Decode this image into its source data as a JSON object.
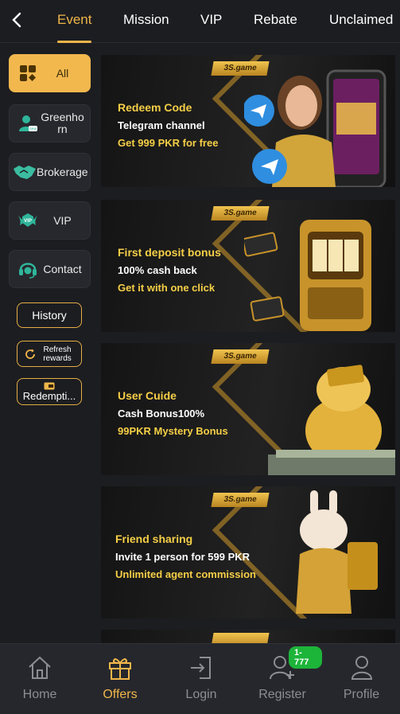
{
  "nav": {
    "back_icon": "chevron-left-icon",
    "tabs": [
      {
        "label": "Event",
        "active": true
      },
      {
        "label": "Mission"
      },
      {
        "label": "VIP"
      },
      {
        "label": "Rebate"
      },
      {
        "label": "Unclaimed"
      }
    ]
  },
  "sidebar": {
    "items": [
      {
        "label": "All",
        "icon": "grid-icon",
        "active": true
      },
      {
        "label": "Greenhorn",
        "icon": "newbie-avatar-icon"
      },
      {
        "label": "Brokerage",
        "icon": "handshake-icon"
      },
      {
        "label": "VIP",
        "icon": "vip-badge-icon"
      },
      {
        "label": "Contact",
        "icon": "headset-icon"
      }
    ],
    "history_label": "History",
    "refresh_label": "Refresh rewards",
    "redemption_label": "Redempti..."
  },
  "banners": [
    {
      "brand": "3S.game",
      "title": "Redeem Code",
      "line2": "Telegram channel",
      "line3": "Get 999 PKR for free"
    },
    {
      "brand": "3S.game",
      "title": "First deposit bonus",
      "line2": "100% cash back",
      "line3": "Get it with one click"
    },
    {
      "brand": "3S.game",
      "title": "User Cuide",
      "line2": "Cash Bonus100%",
      "line3": "99PKR Mystery Bonus"
    },
    {
      "brand": "3S.game",
      "title": "Friend sharing",
      "line2": "Invite 1 person for 599 PKR",
      "line3": "Unlimited agent commission"
    }
  ],
  "bottom_nav": [
    {
      "label": "Home",
      "icon": "home-icon"
    },
    {
      "label": "Offers",
      "icon": "gift-icon",
      "active": true
    },
    {
      "label": "Login",
      "icon": "login-icon"
    },
    {
      "label": "Register",
      "icon": "add-user-icon",
      "badge": "1-777"
    },
    {
      "label": "Profile",
      "icon": "profile-icon"
    }
  ],
  "colors": {
    "accent": "#f0b64a",
    "background": "#1c1d21",
    "badge": "#1db43a"
  }
}
